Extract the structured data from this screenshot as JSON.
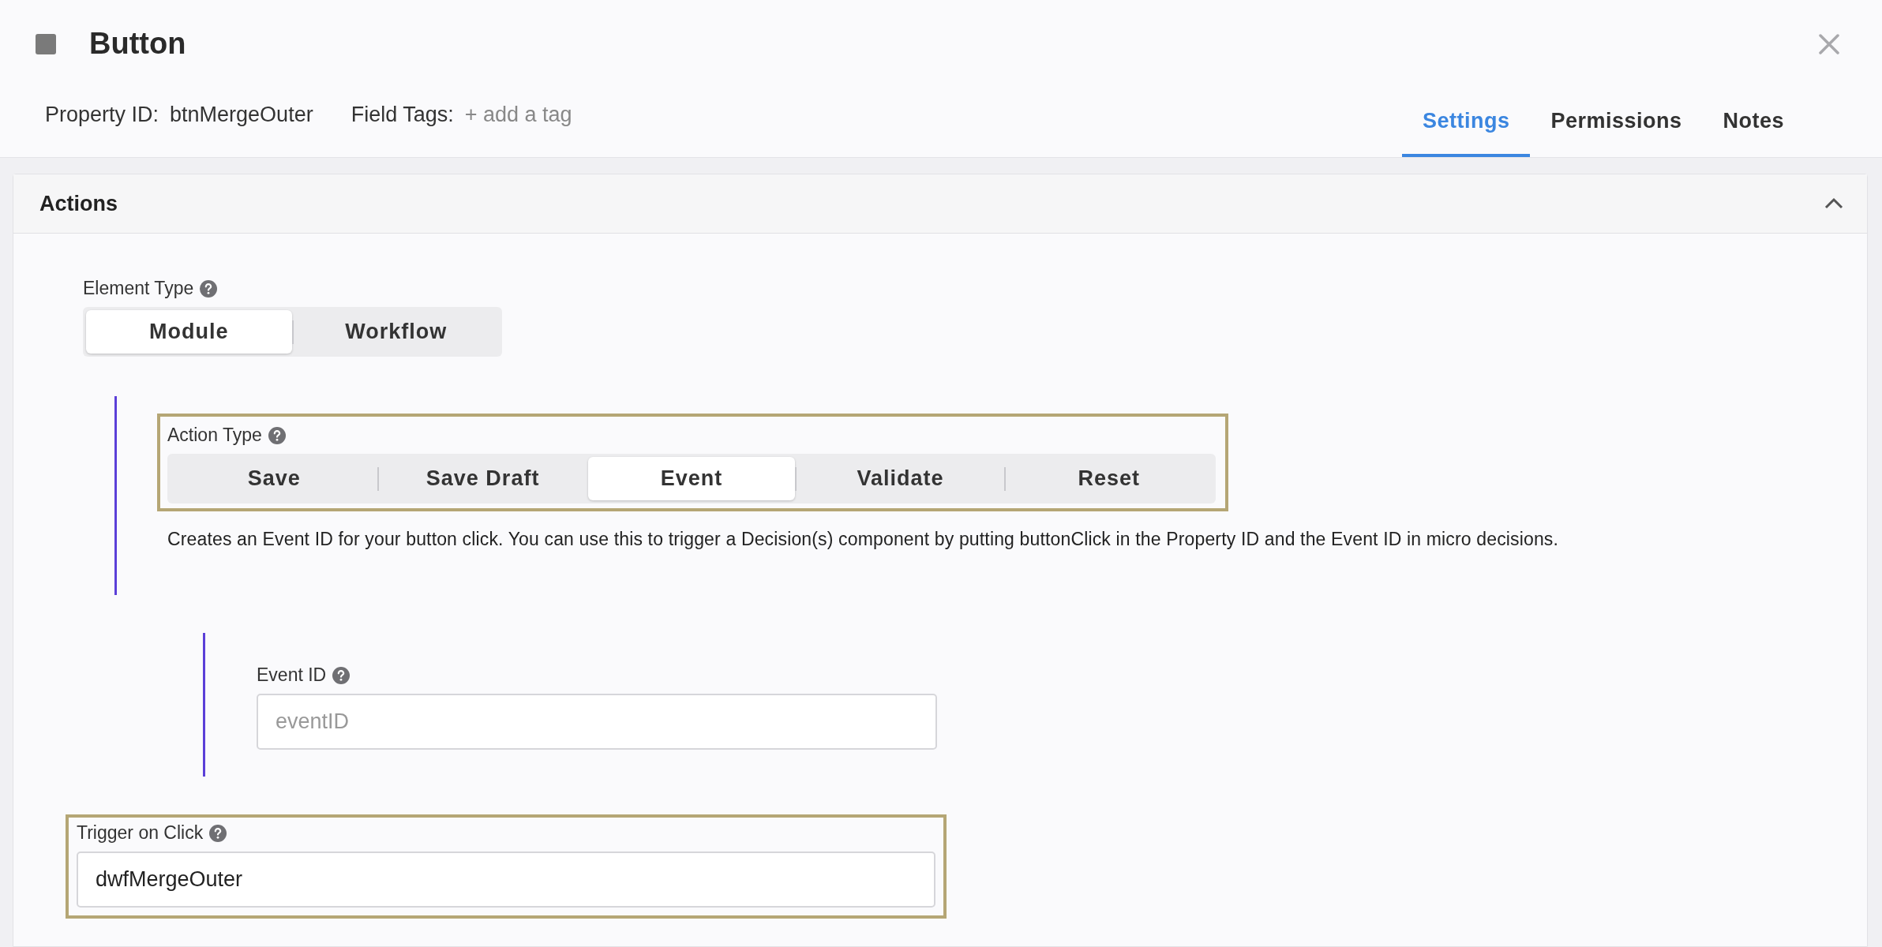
{
  "header": {
    "title": "Button",
    "property_id": {
      "label": "Property ID:",
      "value": "btnMergeOuter"
    },
    "field_tags": {
      "label": "Field Tags:",
      "add_link": "+ add a tag"
    }
  },
  "tabs": [
    {
      "label": "Settings",
      "selected": true
    },
    {
      "label": "Permissions",
      "selected": false
    },
    {
      "label": "Notes",
      "selected": false
    }
  ],
  "panel": {
    "title": "Actions",
    "expanded": true,
    "element_type": {
      "label": "Element Type",
      "options": [
        {
          "label": "Module",
          "selected": true
        },
        {
          "label": "Workflow",
          "selected": false
        }
      ]
    },
    "action_type": {
      "label": "Action Type",
      "highlighted": true,
      "options": [
        {
          "label": "Save",
          "selected": false
        },
        {
          "label": "Save Draft",
          "selected": false
        },
        {
          "label": "Event",
          "selected": true
        },
        {
          "label": "Validate",
          "selected": false
        },
        {
          "label": "Reset",
          "selected": false
        }
      ],
      "description": "Creates an Event ID for your button click. You can use this to trigger a Decision(s) component by putting buttonClick in the Property ID and the Event ID in micro decisions."
    },
    "event_id": {
      "label": "Event ID",
      "placeholder": "eventID"
    },
    "trigger_on_click": {
      "label": "Trigger on Click",
      "highlighted": true,
      "value": "dwfMergeOuter"
    }
  }
}
